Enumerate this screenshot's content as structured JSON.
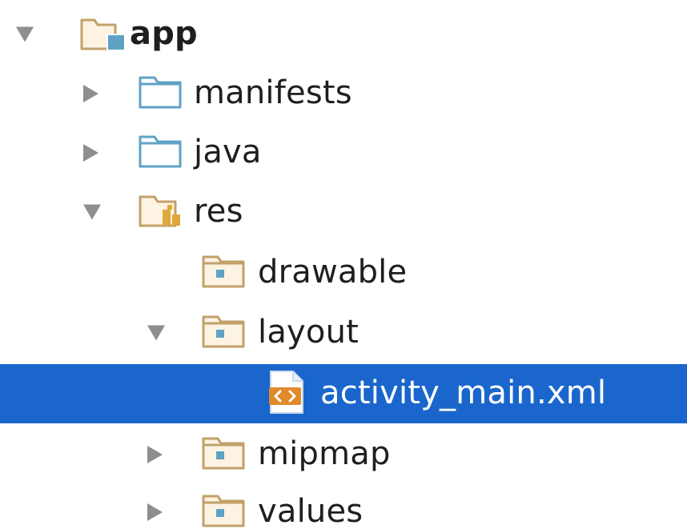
{
  "project_tree": {
    "items": [
      {
        "label": "app",
        "expanded": true,
        "icon": "module-folder-icon"
      },
      {
        "label": "manifests",
        "expanded": false,
        "icon": "source-folder-icon"
      },
      {
        "label": "java",
        "expanded": false,
        "icon": "source-folder-icon"
      },
      {
        "label": "res",
        "expanded": true,
        "icon": "resource-folder-icon"
      },
      {
        "label": "drawable",
        "expanded": false,
        "icon": "resource-subfolder-icon"
      },
      {
        "label": "layout",
        "expanded": true,
        "icon": "resource-subfolder-icon"
      },
      {
        "label": "activity_main.xml",
        "selected": true,
        "icon": "xml-file-icon"
      },
      {
        "label": "mipmap",
        "expanded": false,
        "icon": "resource-subfolder-icon"
      },
      {
        "label": "values",
        "expanded": false,
        "icon": "resource-subfolder-icon"
      }
    ]
  },
  "colors": {
    "selection": "#1a66cc",
    "arrow": "#8e8e8e",
    "source_folder": "#5fa3c4",
    "resource_folder": "#c2a16a",
    "xml_file": "#e08a2c"
  }
}
